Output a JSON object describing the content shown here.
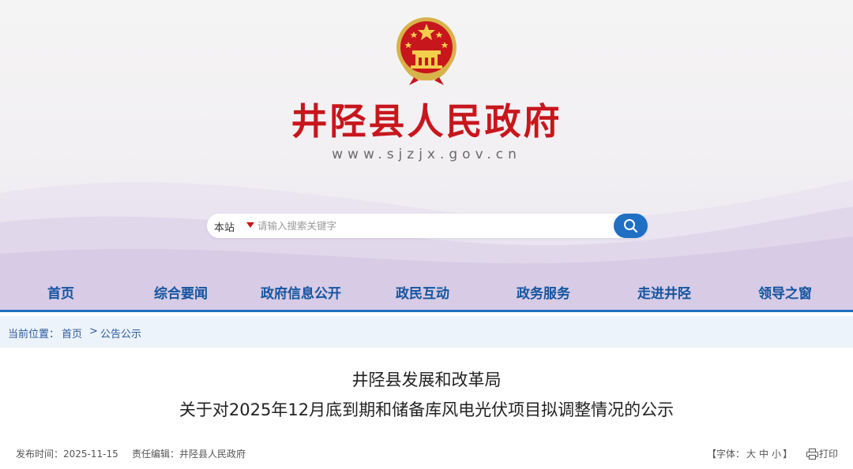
{
  "header": {
    "site_title": "井陉县人民政府",
    "site_url": "www.sjzjx.gov.cn",
    "emblem_icon": "national-emblem-icon"
  },
  "search": {
    "scope": "本站",
    "placeholder": "请输入搜索关键字",
    "button_icon": "search-icon"
  },
  "nav": {
    "items": [
      {
        "label": "首页"
      },
      {
        "label": "综合要闻"
      },
      {
        "label": "政府信息公开"
      },
      {
        "label": "政民互动"
      },
      {
        "label": "政务服务"
      },
      {
        "label": "走进井陉"
      },
      {
        "label": "领导之窗"
      }
    ]
  },
  "breadcrumb": {
    "prefix": "当前位置：",
    "home": "首页",
    "separator": ">",
    "current": "公告公示"
  },
  "article": {
    "title_line1": "井陉县发展和改革局",
    "title_line2": "关于对2025年12月底到期和储备库风电光伏项目拟调整情况的公示",
    "publish_label": "发布时间：",
    "publish_date": "2025-11-15",
    "editor_label": "责任编辑：",
    "editor": "井陉县人民政府",
    "font_open": "【字体：",
    "font_large": "大",
    "font_medium": "中",
    "font_small": "小",
    "font_close": "】",
    "print_label": "打印"
  },
  "colors": {
    "title_red": "#c8161d",
    "nav_blue": "#1455a0",
    "accent_blue": "#1b6ec0",
    "breadcrumb_bg": "#edf3fa"
  }
}
